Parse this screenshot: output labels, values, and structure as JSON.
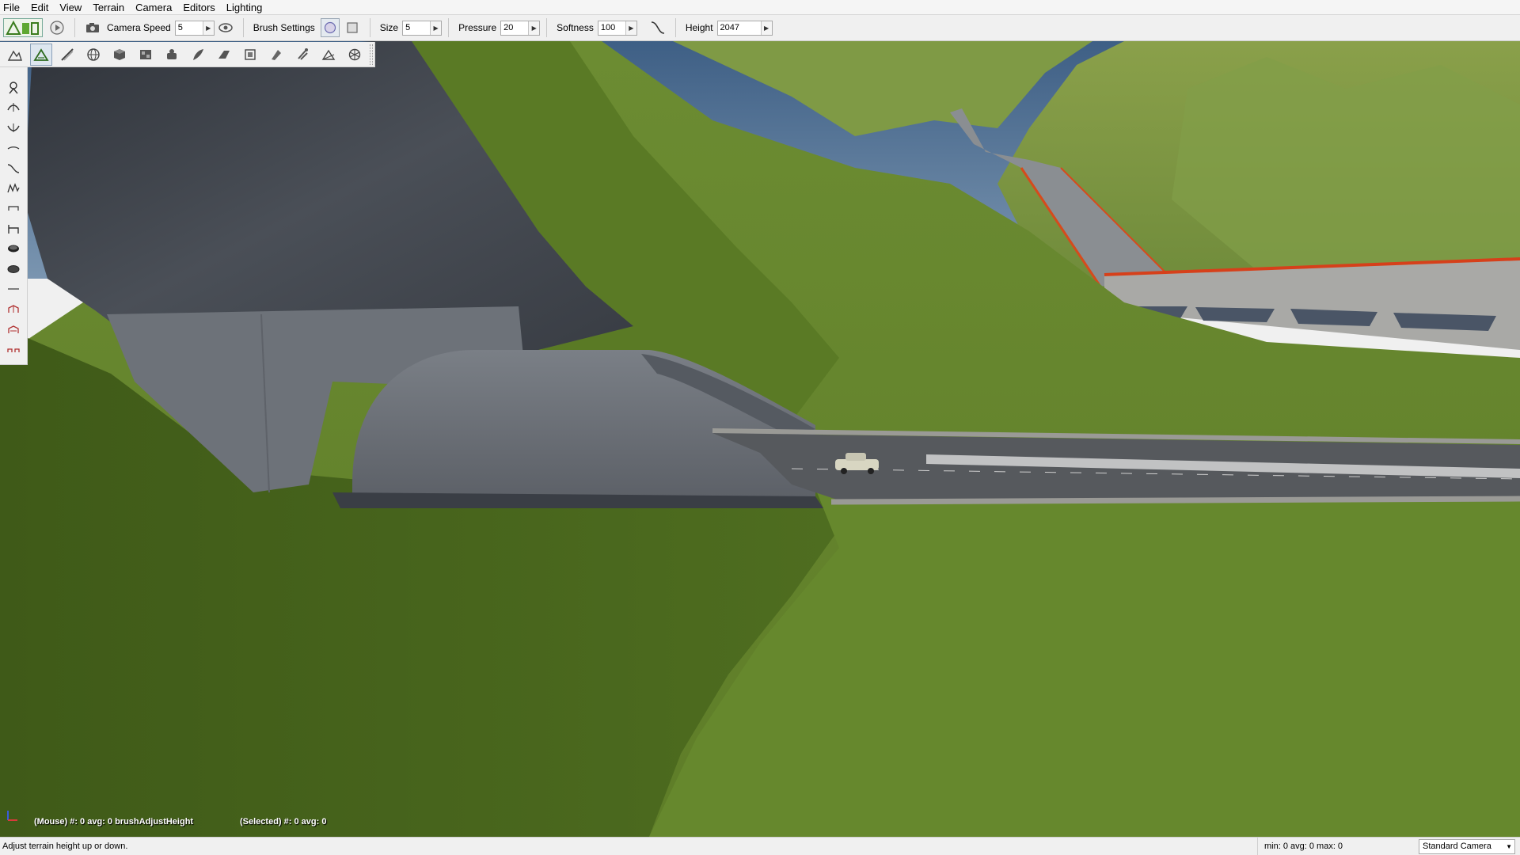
{
  "menu": {
    "items": [
      "File",
      "Edit",
      "View",
      "Terrain",
      "Camera",
      "Editors",
      "Lighting"
    ]
  },
  "toolbar": {
    "camera_speed_label": "Camera Speed",
    "camera_speed_value": "5",
    "brush_settings_label": "Brush Settings",
    "size_label": "Size",
    "size_value": "5",
    "pressure_label": "Pressure",
    "pressure_value": "20",
    "softness_label": "Softness",
    "softness_value": "100",
    "height_label": "Height",
    "height_value": "2047"
  },
  "terrain_tools": {
    "icons": [
      "terrain-mode-icon",
      "raise-terrain-icon",
      "road-tool-icon",
      "globe-icon",
      "cube-icon",
      "material-icon",
      "object-icon",
      "forest-icon",
      "river-icon",
      "decal-icon",
      "mesh-road-icon",
      "particle-icon",
      "ramp-icon",
      "navmesh-icon"
    ]
  },
  "left_tools": {
    "icons": [
      "select-brush-icon",
      "raise-height-icon",
      "lower-height-icon",
      "smooth-icon",
      "slope-icon",
      "noise-icon",
      "flatten-icon",
      "set-height-icon",
      "paint-icon",
      "erase-icon",
      "clear-icon",
      "empty-icon",
      "fill-icon",
      "brush-stamp-icon"
    ]
  },
  "viewport": {
    "mouse_info": "(Mouse) #: 0  avg: 0 brushAdjustHeight",
    "selected_info": "(Selected) #: 0  avg: 0"
  },
  "status": {
    "message": "Adjust terrain height up or down.",
    "stats": "min: 0  avg: 0  max: 0",
    "camera": "Standard Camera"
  },
  "colors": {
    "sky": "#4a6a8e",
    "grass": "#6b8a2e",
    "rock": "#3d4148",
    "tunnel": "#6b7077",
    "road": "#55585c"
  }
}
